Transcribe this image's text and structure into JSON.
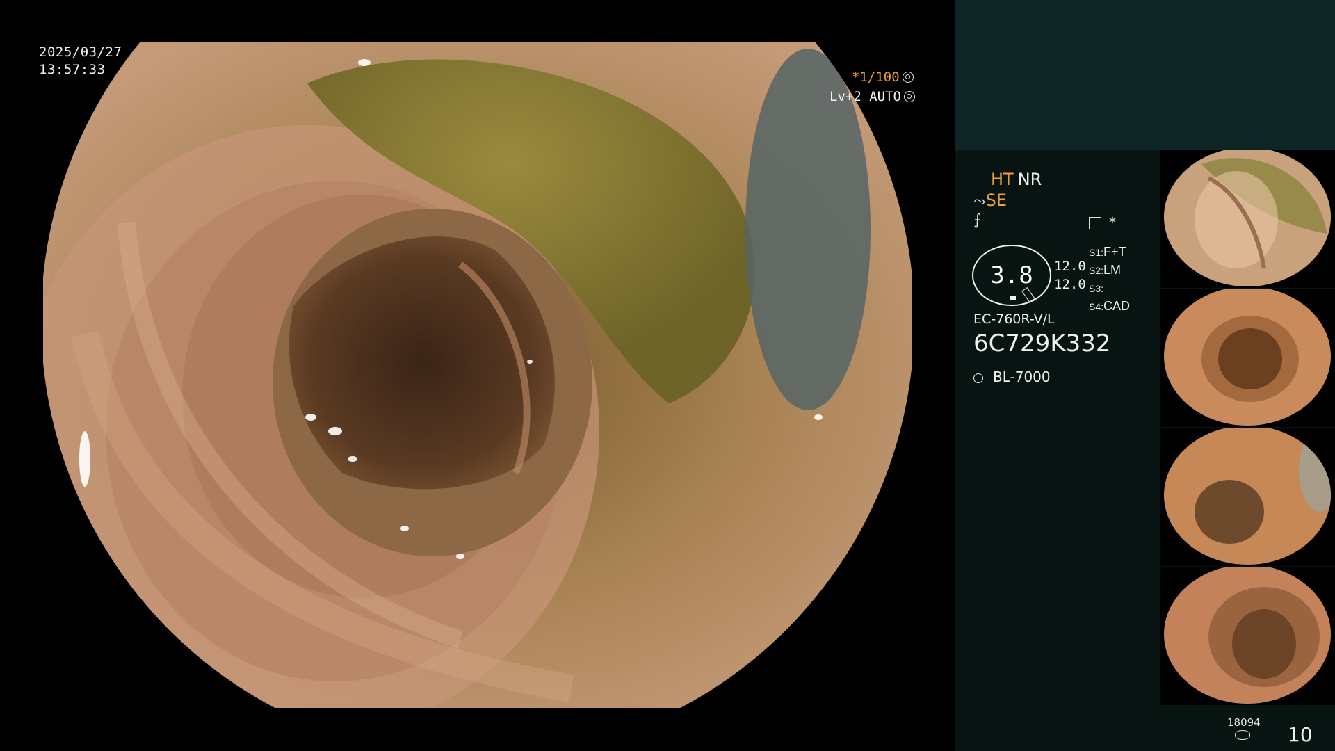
{
  "overlay": {
    "date": "2025/03/27",
    "time": "13:57:33",
    "shutter": "*1/100",
    "level": "Lv+2 AUTO"
  },
  "panel": {
    "ht_label": "HT",
    "nr_label": "NR",
    "se_label": "SE",
    "asterisk": "*",
    "dial_value": "3.8",
    "num1": "12.0",
    "num2": "12.0",
    "switches": [
      {
        "key": "S1:",
        "value": "F+T"
      },
      {
        "key": "S2:",
        "value": "LM"
      },
      {
        "key": "S3:",
        "value": ""
      },
      {
        "key": "S4:",
        "value": "CAD"
      }
    ],
    "scope_model": "EC-760R-V/L",
    "scope_serial": "6C729K332",
    "light_source": "BL-7000",
    "counter": "18094",
    "page_number": "10",
    "accent_color": "#f0a030"
  }
}
